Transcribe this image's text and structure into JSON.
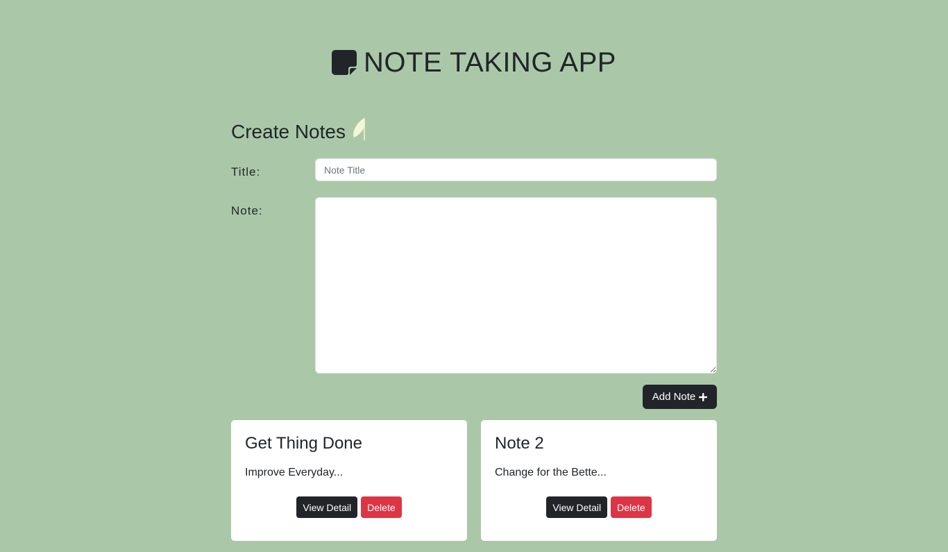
{
  "header": {
    "title": "NOTE TAKING APP",
    "icon": "sticky-note-icon"
  },
  "create_section": {
    "title": "Create Notes",
    "icon": "feather-icon"
  },
  "form": {
    "title_label": "Title:",
    "title_placeholder": "Note Title",
    "title_value": "",
    "note_label": "Note:",
    "note_value": "",
    "add_button_label": "Add Note",
    "add_button_icon": "plus-icon"
  },
  "notes": [
    {
      "title": "Get Thing Done",
      "preview": "Improve Everyday...",
      "view_label": "View Detail",
      "delete_label": "Delete"
    },
    {
      "title": "Note 2",
      "preview": "Change for the Bette...",
      "view_label": "View Detail",
      "delete_label": "Delete"
    }
  ],
  "colors": {
    "background": "#aac8a8",
    "dark": "#212529",
    "danger": "#dc3545",
    "feather": "#f2f7da",
    "card": "#ffffff"
  }
}
